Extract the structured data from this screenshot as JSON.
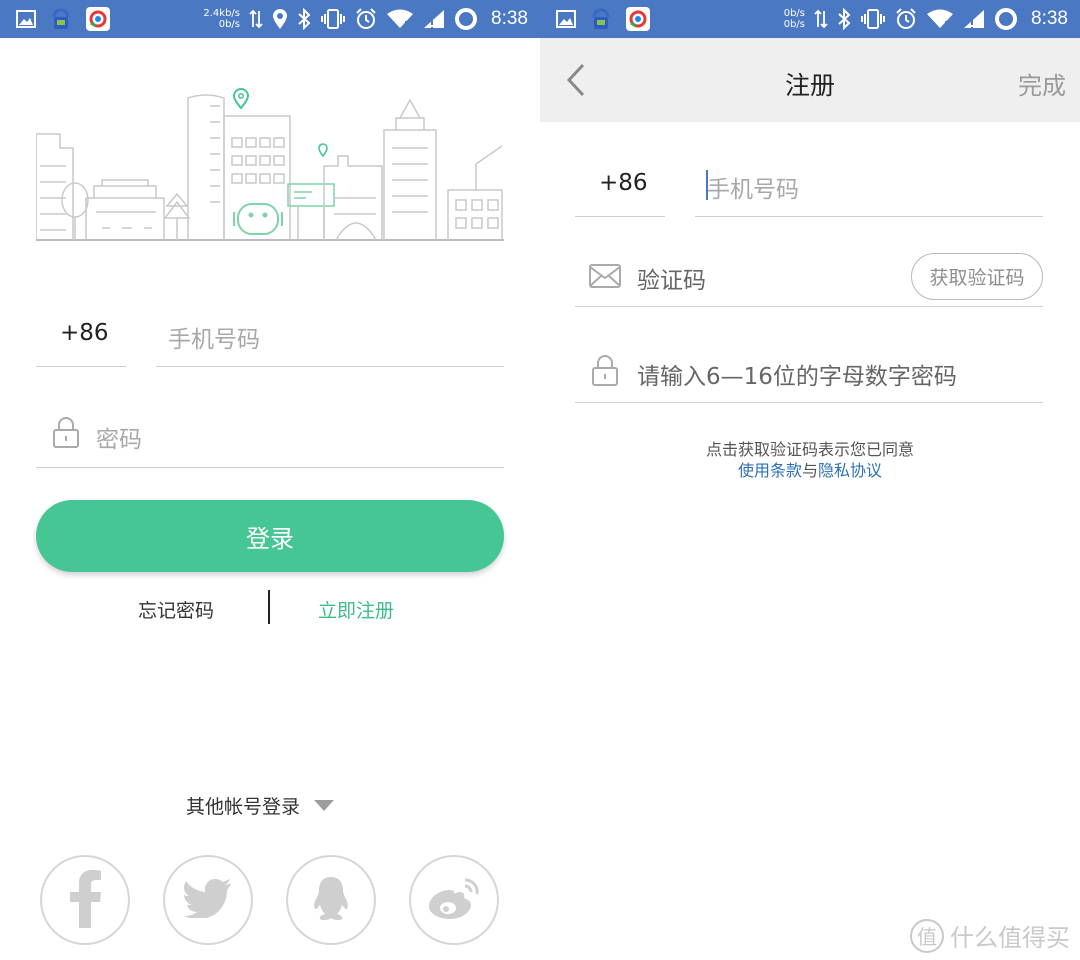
{
  "status_left": {
    "speed_up": "2.4kb/s",
    "speed_down": "0b/s",
    "time": "8:38"
  },
  "status_right": {
    "speed_up": "0b/s",
    "speed_down": "0b/s",
    "time": "8:38"
  },
  "login": {
    "country_code": "+86",
    "phone_placeholder": "手机号码",
    "password_placeholder": "密码",
    "login_label": "登录",
    "forgot_label": "忘记密码",
    "register_label": "立即注册",
    "other_label": "其他帐号登录",
    "social": [
      "facebook-icon",
      "twitter-icon",
      "qq-icon",
      "weibo-icon"
    ]
  },
  "register": {
    "back_icon": "back-arrow-icon",
    "title": "注册",
    "done_label": "完成",
    "country_code": "+86",
    "phone_placeholder": "手机号码",
    "code_placeholder": "验证码",
    "get_code_label": "获取验证码",
    "password_placeholder": "请输入6—16位的字母数字密码",
    "terms_line": "点击获取验证码表示您已同意",
    "terms_link": "使用条款",
    "terms_and": "与",
    "privacy_link": "隐私协议"
  },
  "watermark": {
    "text": "什么值得买",
    "logo": "值"
  },
  "colors": {
    "status_bar": "#4b78c3",
    "accent_green": "#45c694",
    "link_blue": "#2e6fb8",
    "nav_bg": "#efefef"
  }
}
